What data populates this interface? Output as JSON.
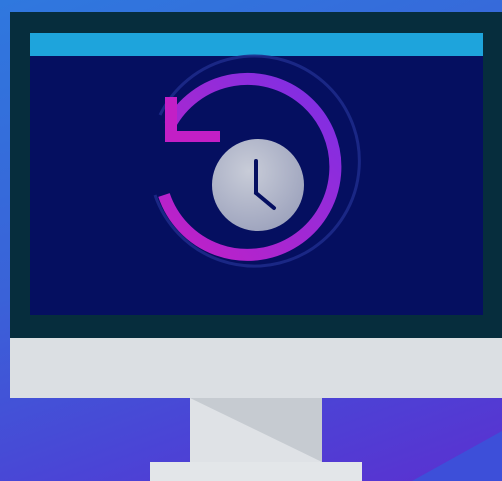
{
  "illustration": {
    "subject": "desktop-monitor",
    "icon": "history-clock-icon",
    "colors": {
      "background": "#3a62d8",
      "frame": "#062d3d",
      "screen": "#050f60",
      "screen_bar": "#1ea4dc",
      "arrow_start": "#c31fc6",
      "arrow_end": "#7a2fe6",
      "clock_face": "#b8bccb",
      "stand": "#dfe2e6"
    }
  }
}
